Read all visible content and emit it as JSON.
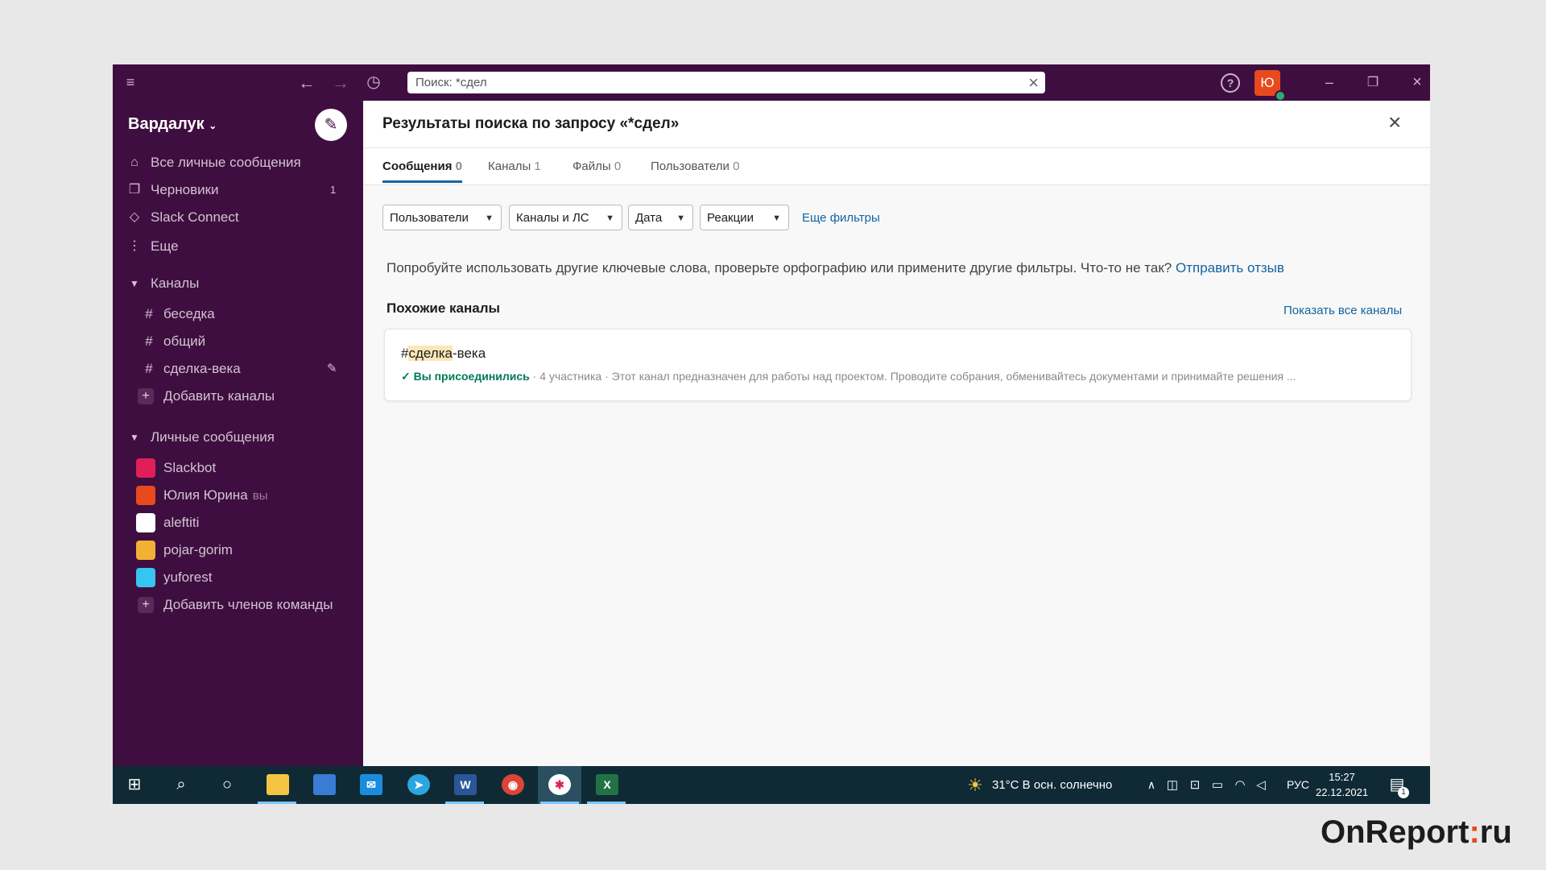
{
  "titlebar": {
    "search_value": "Поиск: *сдел",
    "icons": [
      "menu-icon",
      "back-arrow-icon",
      "forward-arrow-icon",
      "history-icon",
      "help-icon",
      "minimize-icon",
      "restore-icon",
      "close-icon"
    ],
    "user_avatar_letter": "Ю"
  },
  "sidebar": {
    "workspace": "Вардалук",
    "nav": [
      {
        "label": "Все личные сообщения",
        "icon": "dm-icon"
      },
      {
        "label": "Черновики",
        "icon": "drafts-icon",
        "count": "1"
      },
      {
        "label": "Slack Connect",
        "icon": "connect-icon"
      },
      {
        "label": "Еще",
        "icon": "more-icon"
      }
    ],
    "channels_header": "Каналы",
    "channels": [
      "беседка",
      "общий",
      "сделка-века"
    ],
    "add_channels": "Добавить каналы",
    "dm_header": "Личные сообщения",
    "dms": [
      {
        "name": "Slackbot",
        "color": "#e01e5a"
      },
      {
        "name": "Юлия Юрина",
        "you": "вы",
        "color": "#e8491d"
      },
      {
        "name": "aleftiti",
        "color": "#ffffff"
      },
      {
        "name": "pojar-gorim",
        "color": "#f2b134"
      },
      {
        "name": "yuforest",
        "color": "#36c5f0"
      }
    ],
    "add_members": "Добавить членов команды"
  },
  "main": {
    "title": "Результаты поиска по запросу «*сдел»",
    "tabs": [
      {
        "label": "Сообщения",
        "count": "0"
      },
      {
        "label": "Каналы",
        "count": "1"
      },
      {
        "label": "Файлы",
        "count": "0"
      },
      {
        "label": "Пользователи",
        "count": "0"
      }
    ],
    "filters": [
      "Пользователи",
      "Каналы и ЛС",
      "Дата",
      "Реакции"
    ],
    "more_filters": "Еще фильтры",
    "hint": "Попробуйте использовать другие ключевые слова, проверьте орфографию или примените другие фильтры. Что-то не так?",
    "hint_link": "Отправить отзыв",
    "similar_title": "Похожие каналы",
    "show_all": "Показать все каналы",
    "channel": {
      "hash": "#",
      "highlight": "сделка",
      "rest": "-века",
      "joined": "Вы присоединились",
      "members": "4 участника",
      "description": "Этот канал предназначен для работы над проектом. Проводите собрания, обменивайтесь документами и принимайте решения ..."
    }
  },
  "taskbar": {
    "weather": "31°C  В осн. солнечно",
    "lang": "РУС",
    "time": "15:27",
    "date": "22.12.2021",
    "notification_count": "1"
  },
  "brand": {
    "left": "OnReport",
    "colon": ":",
    "right": "ru"
  }
}
